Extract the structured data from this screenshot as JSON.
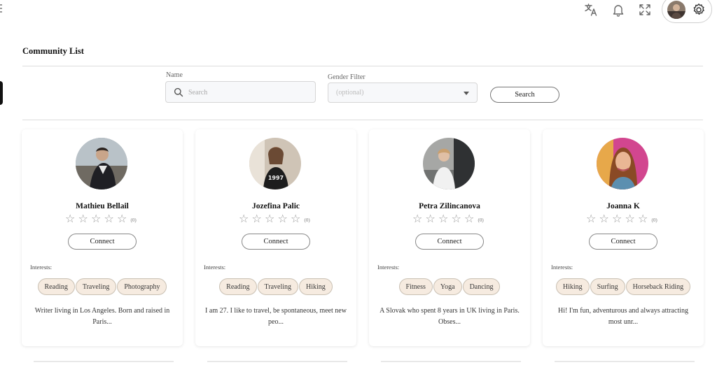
{
  "page": {
    "title": "Community List"
  },
  "topbar": {
    "icons": [
      "translate-icon",
      "bell-icon",
      "fullscreen-icon",
      "avatar",
      "gear-icon"
    ]
  },
  "filters": {
    "name_label": "Name",
    "search_placeholder": "Search",
    "gender_label": "Gender Filter",
    "gender_placeholder": "(optional)",
    "search_button": "Search"
  },
  "cards": [
    {
      "name": "Mathieu Bellail",
      "rating": 0,
      "review_count": "(0)",
      "connect_label": "Connect",
      "interests_label": "Interests:",
      "interests": [
        "Reading",
        "Traveling",
        "Photography"
      ],
      "bio": "Writer living in Los Angeles. Born and raised in Paris..."
    },
    {
      "name": "Jozefina Palic",
      "rating": 0,
      "review_count": "(0)",
      "connect_label": "Connect",
      "interests_label": "Interests:",
      "interests": [
        "Reading",
        "Traveling",
        "Hiking"
      ],
      "bio": "I am 27. I like to travel, be spontaneous, meet new peo..."
    },
    {
      "name": "Petra Zilincanova",
      "rating": 0,
      "review_count": "(0)",
      "connect_label": "Connect",
      "interests_label": "Interests:",
      "interests": [
        "Fitness",
        "Yoga",
        "Dancing"
      ],
      "bio": "A Slovak who spent 8 years in UK living in Paris. Obses..."
    },
    {
      "name": "Joanna K",
      "rating": 0,
      "review_count": "(0)",
      "connect_label": "Connect",
      "interests_label": "Interests:",
      "interests": [
        "Hiking",
        "Surfing",
        "Horseback Riding"
      ],
      "bio": "Hi! I'm fun, adventurous and always attracting most unr..."
    }
  ],
  "colors": {
    "chip_bg": "#f6ebe0",
    "chip_border": "#c9c0b3",
    "star": "#999999",
    "divider": "#dcdcdc"
  }
}
